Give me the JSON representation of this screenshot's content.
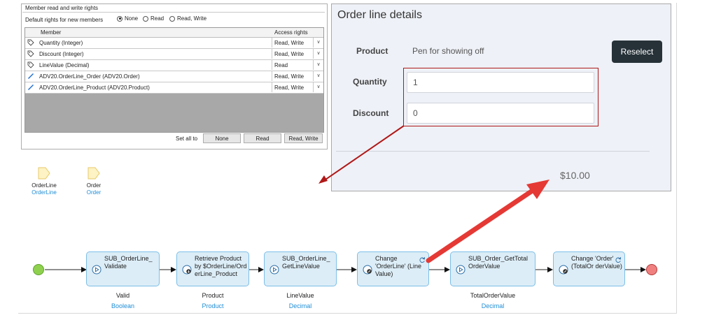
{
  "member_rights": {
    "title": "Member read and write rights",
    "default_label": "Default rights for new members",
    "radio_options": [
      "None",
      "Read",
      "Read, Write"
    ],
    "selected_option": "None",
    "columns": [
      "Member",
      "Access rights"
    ],
    "rows": [
      {
        "member": "Quantity (Integer)",
        "rights": "Read, Write",
        "icon": "tag-icon"
      },
      {
        "member": "Discount (Integer)",
        "rights": "Read, Write",
        "icon": "tag-icon"
      },
      {
        "member": "LineValue (Decimal)",
        "rights": "Read",
        "icon": "tag-icon"
      },
      {
        "member": "ADV20.OrderLine_Order (ADV20.Order)",
        "rights": "Read, Write",
        "icon": "association-icon"
      },
      {
        "member": "ADV20.OrderLine_Product (ADV20.Product)",
        "rights": "Read, Write",
        "icon": "association-icon"
      }
    ],
    "set_all_label": "Set all to",
    "set_all_buttons": [
      "None",
      "Read",
      "Read, Write"
    ]
  },
  "entities": [
    {
      "name": "OrderLine",
      "type": "OrderLine"
    },
    {
      "name": "Order",
      "type": "Order"
    }
  ],
  "order_line": {
    "title": "Order line details",
    "product_label": "Product",
    "product_value": "Pen for showing off",
    "reselect_label": "Reselect",
    "quantity_label": "Quantity",
    "quantity_value": "1",
    "discount_label": "Discount",
    "discount_value": "0",
    "total": "$10.00"
  },
  "microflow": {
    "nodes": [
      {
        "text": "SUB_OrderLine_ Validate",
        "output": "Valid",
        "type": "Boolean",
        "icon": "call-microflow-icon"
      },
      {
        "text": "Retrieve Product by $OrderLine/Ord erLine_Product",
        "output": "Product",
        "type": "Product",
        "icon": "retrieve-icon"
      },
      {
        "text": "SUB_OrderLine_ GetLineValue",
        "output": "LineValue",
        "type": "Decimal",
        "icon": "call-microflow-icon"
      },
      {
        "text": "Change 'OrderLine' (Line Value)",
        "output": "",
        "type": "",
        "icon": "change-object-icon"
      },
      {
        "text": "SUB_Order_GetTotal OrderValue",
        "output": "TotalOrderValue",
        "type": "Decimal",
        "icon": "call-microflow-icon"
      },
      {
        "text": "Change 'Order' (TotalOr derValue)",
        "output": "",
        "type": "",
        "icon": "change-object-icon"
      }
    ]
  },
  "colors": {
    "accent_blue": "#1f8dd6",
    "node_fill": "#dcedf7",
    "node_border": "#7cbfe8",
    "start_event": "#8fd14f",
    "end_event": "#f08080",
    "annotation_red": "#e53935",
    "dark_button": "#263238"
  }
}
